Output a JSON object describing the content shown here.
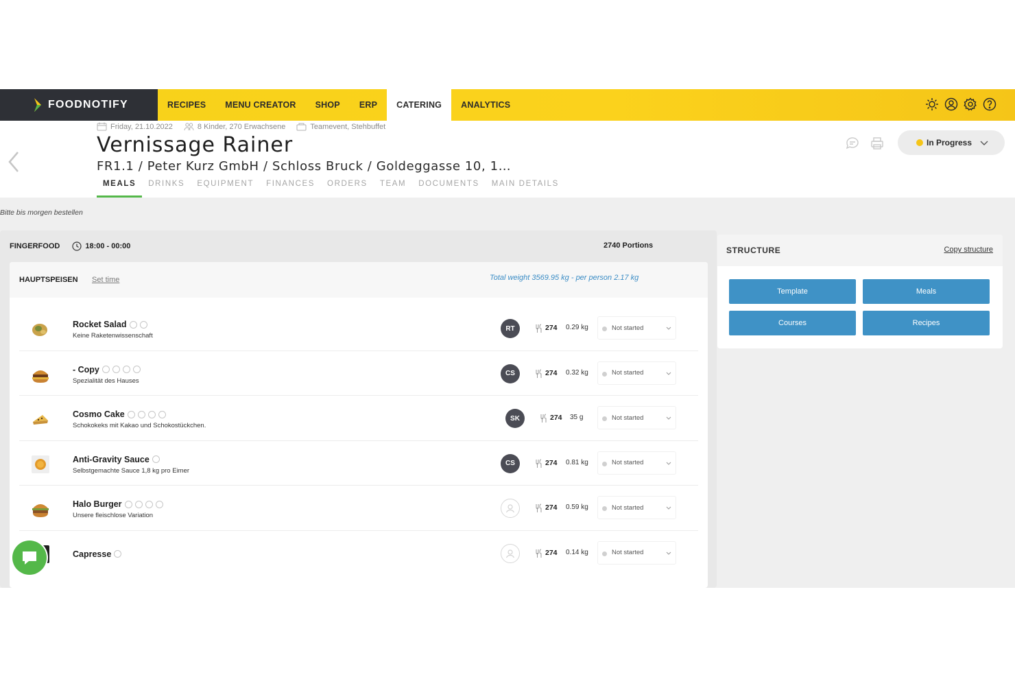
{
  "app": {
    "logo": "FOODNOTIFY"
  },
  "nav": {
    "items": [
      {
        "label": "RECIPES",
        "active": false
      },
      {
        "label": "MENU CREATOR",
        "active": false
      },
      {
        "label": "SHOP",
        "active": false
      },
      {
        "label": "ERP",
        "active": false
      },
      {
        "label": "CATERING",
        "active": true
      },
      {
        "label": "ANALYTICS",
        "active": false
      }
    ],
    "icons": [
      "sun-icon",
      "user-icon",
      "gear-icon",
      "help-icon"
    ]
  },
  "event": {
    "date": "Friday, 21.10.2022",
    "guests": "8 Kinder, 270 Erwachsene",
    "type": "Teamevent, Stehbuffet",
    "title": "Vernissage Rainer",
    "subtitle": "FR1.1 / Peter Kurz GmbH / Schloss Bruck / Goldeggasse 10, 1…",
    "status": "In Progress",
    "note": "Bitte bis morgen bestellen"
  },
  "subtabs": [
    {
      "label": "MEALS",
      "active": true
    },
    {
      "label": "DRINKS",
      "active": false
    },
    {
      "label": "EQUIPMENT",
      "active": false
    },
    {
      "label": "FINANCES",
      "active": false
    },
    {
      "label": "ORDERS",
      "active": false
    },
    {
      "label": "TEAM",
      "active": false
    },
    {
      "label": "DOCUMENTS",
      "active": false
    },
    {
      "label": "MAIN DETAILS",
      "active": false
    }
  ],
  "meals": {
    "section": "FINGERFOOD",
    "time": "18:00 - 00:00",
    "portions": "2740 Portions",
    "course": {
      "title": "HAUPTSPEISEN",
      "set_time": "Set time",
      "total": "Total weight 3569.95 kg - per person 2.17 kg"
    },
    "rows": [
      {
        "name": "Rocket Salad",
        "desc": "Keine Raketenwissenschaft",
        "allergens": 2,
        "avatar": "RT",
        "count": "274",
        "weight": "0.29 kg",
        "status": "Not started"
      },
      {
        "name": "- Copy",
        "desc": "Spezialität des Hauses",
        "allergens": 4,
        "avatar": "CS",
        "count": "274",
        "weight": "0.32 kg",
        "status": "Not started"
      },
      {
        "name": "Cosmo Cake",
        "desc": "Schokokeks mit Kakao und Schokostückchen.",
        "allergens": 4,
        "avatar": "SK",
        "count": "274",
        "weight": "35 g",
        "status": "Not started"
      },
      {
        "name": "Anti-Gravity Sauce",
        "desc": "Selbstgemachte Sauce 1,8 kg pro Eimer",
        "allergens": 1,
        "avatar": "CS",
        "count": "274",
        "weight": "0.81 kg",
        "status": "Not started"
      },
      {
        "name": "Halo Burger",
        "desc": "Unsere fleischlose Variation",
        "allergens": 4,
        "avatar": "",
        "count": "274",
        "weight": "0.59 kg",
        "status": "Not started"
      },
      {
        "name": "Capresse",
        "desc": "",
        "allergens": 1,
        "avatar": "",
        "count": "274",
        "weight": "0.14 kg",
        "status": "Not started"
      }
    ]
  },
  "structure": {
    "title": "STRUCTURE",
    "copy": "Copy structure",
    "buttons": [
      "Template",
      "Meals",
      "Courses",
      "Recipes"
    ]
  },
  "colors": {
    "brand_yellow": "#f7d21a",
    "dark": "#2e3036",
    "accent_green": "#54b849",
    "button_blue": "#3f92c6",
    "status_yellow": "#f5c518"
  }
}
